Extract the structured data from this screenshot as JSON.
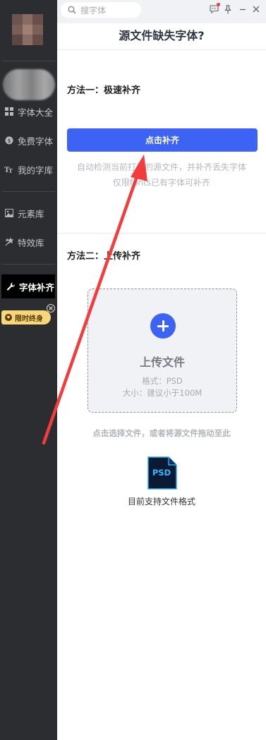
{
  "search": {
    "placeholder": "搜字体"
  },
  "sidebar": {
    "items": [
      {
        "label": "字体大全"
      },
      {
        "label": "免费字体"
      },
      {
        "label": "我的字库"
      },
      {
        "label": "元素库"
      },
      {
        "label": "特效库"
      },
      {
        "label": "字体补齐"
      }
    ],
    "vip_label": "限时终身"
  },
  "main": {
    "title": "源文件缺失字体?",
    "method1": {
      "label": "方法一：极速补齐",
      "button": "点击补齐",
      "desc_line1": "自动检测当前打开的源文件，并补齐丢失字体",
      "desc_line2": "仅限fonts已有字体可补齐"
    },
    "method2": {
      "label": "方法二：上传补齐",
      "upload_title": "上传文件",
      "format": "格式：PSD",
      "size": "大小：建议小于100M",
      "hint": "点击选择文件，或者将源文件拖动至此"
    },
    "support": {
      "badge": "PSD",
      "label": "目前支持文件格式"
    }
  },
  "colors": {
    "accent": "#3d63f5",
    "sidebar": "#2b2d31",
    "arrow": "#f23d3d"
  }
}
